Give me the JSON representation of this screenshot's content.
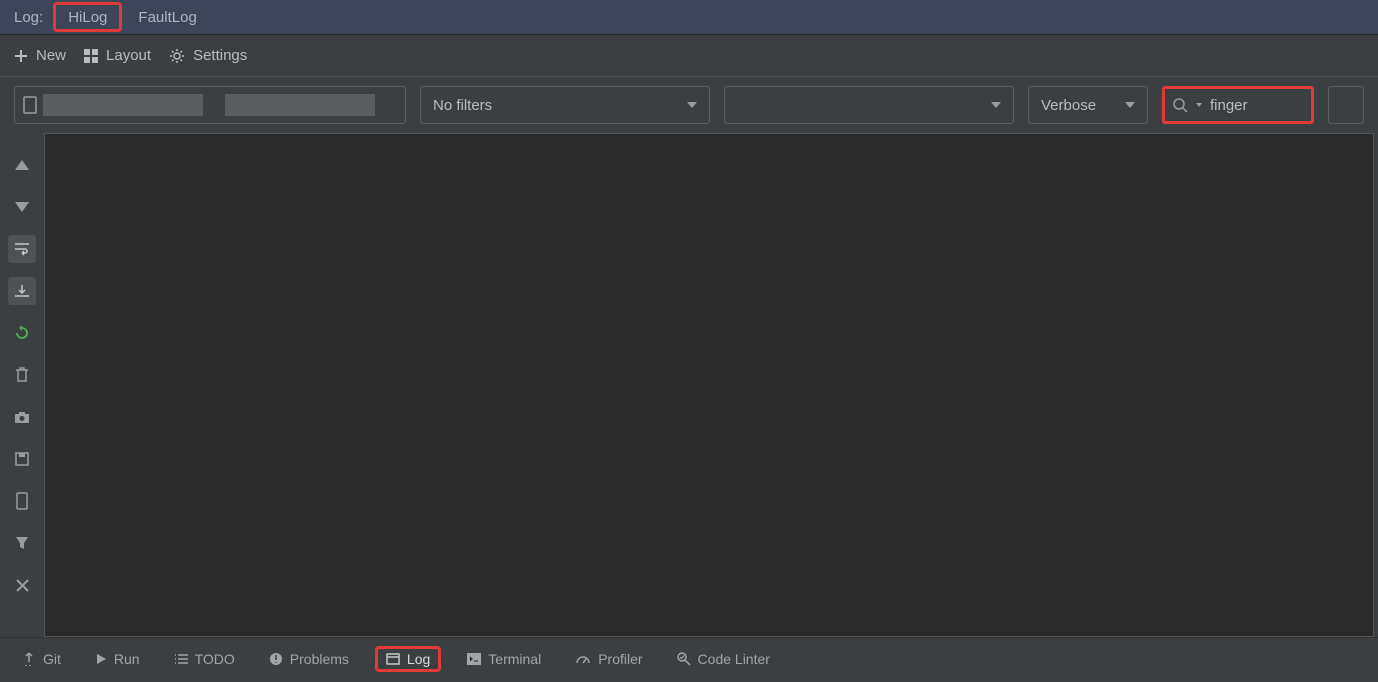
{
  "topbar": {
    "label": "Log:",
    "tabs": [
      {
        "label": "HiLog",
        "highlighted": true
      },
      {
        "label": "FaultLog",
        "highlighted": false
      }
    ]
  },
  "toolbar": {
    "new_label": "New",
    "layout_label": "Layout",
    "settings_label": "Settings"
  },
  "filters": {
    "no_filters_label": "No filters",
    "process_label": "",
    "level_label": "Verbose",
    "search_value": "finger"
  },
  "bottom": {
    "items": [
      {
        "label": "Git",
        "icon": "git"
      },
      {
        "label": "Run",
        "icon": "run"
      },
      {
        "label": "TODO",
        "icon": "todo"
      },
      {
        "label": "Problems",
        "icon": "problems"
      },
      {
        "label": "Log",
        "icon": "log",
        "highlighted": true
      },
      {
        "label": "Terminal",
        "icon": "terminal"
      },
      {
        "label": "Profiler",
        "icon": "profiler"
      },
      {
        "label": "Code Linter",
        "icon": "linter"
      }
    ]
  }
}
